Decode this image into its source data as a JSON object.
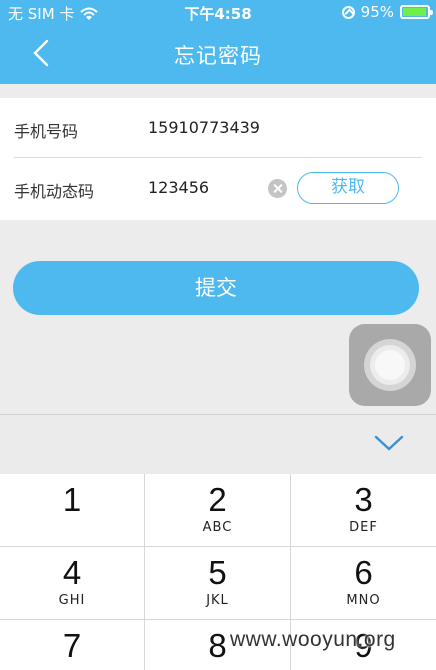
{
  "status_bar": {
    "carrier": "无 SIM 卡",
    "time": "下午4:58",
    "battery_percent_label": "95%",
    "battery_level": 0.95,
    "icons": [
      "wifi-icon",
      "rotation-lock-icon",
      "battery-icon"
    ]
  },
  "nav": {
    "back_icon": "chevron-left-icon",
    "title": "忘记密码"
  },
  "form": {
    "phone_label": "手机号码",
    "phone_value": "15910773439",
    "code_label": "手机动态码",
    "code_value": "123456",
    "clear_icon": "clear-circle-icon",
    "get_code_label": "获取"
  },
  "submit_label": "提交",
  "keyboard": {
    "hide_icon": "chevron-down-icon",
    "keys": [
      {
        "num": "1",
        "letters": ""
      },
      {
        "num": "2",
        "letters": "ABC"
      },
      {
        "num": "3",
        "letters": "DEF"
      },
      {
        "num": "4",
        "letters": "GHI"
      },
      {
        "num": "5",
        "letters": "JKL"
      },
      {
        "num": "6",
        "letters": "MNO"
      },
      {
        "num": "7",
        "letters": ""
      },
      {
        "num": "8",
        "letters": ""
      },
      {
        "num": "9",
        "letters": ""
      }
    ]
  },
  "watermark": "www.wooyun.org",
  "colors": {
    "accent": "#4db9ee",
    "background": "#ececec",
    "battery_fill": "#6ef04b"
  }
}
